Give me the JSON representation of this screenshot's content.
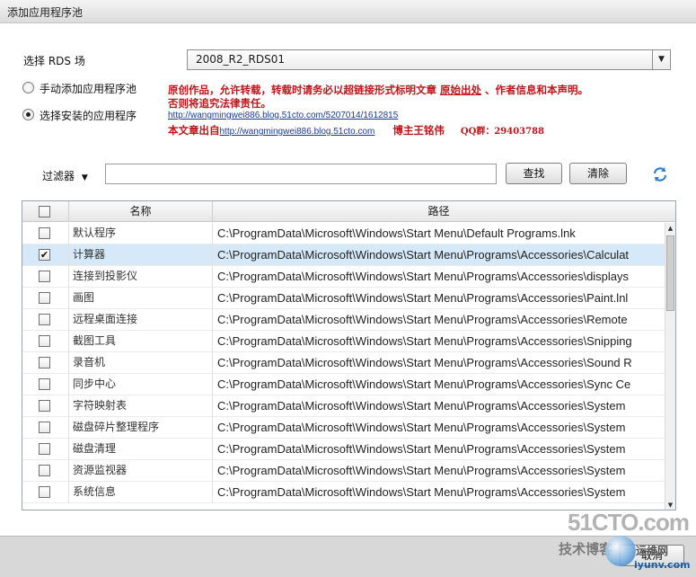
{
  "window": {
    "title": "添加应用程序池"
  },
  "rds": {
    "label": "选择 RDS 场",
    "selected": "2008_R2_RDS01"
  },
  "source_options": [
    {
      "label": "手动添加应用程序池",
      "checked": false
    },
    {
      "label": "选择安装的应用程序",
      "checked": true
    }
  ],
  "notice": {
    "line1_prefix": "原创作品，允许转载，转载时请务必以超链接形式标明文章",
    "line1_link": "原始出处",
    "line1_suffix": "、作者信息和本声明。",
    "line2": "否则将追究法律责任。",
    "url": "http://wangmingwei886.blog.51cto.com/5207014/1612815",
    "line4_prefix": "本文章出自",
    "blog_url": "http://wangmingwei886.blog.51cto.com",
    "author": "博主王铭伟",
    "qq": "QQ群：29403788"
  },
  "filter": {
    "label": "过滤器",
    "value": "",
    "find_label": "查找",
    "clear_label": "清除",
    "refresh_icon": "refresh-icon"
  },
  "table": {
    "columns": [
      "名称",
      "路径"
    ],
    "rows": [
      {
        "name": "默认程序",
        "path": "C:\\ProgramData\\Microsoft\\Windows\\Start Menu\\Default Programs.lnk",
        "checked": false
      },
      {
        "name": "计算器",
        "path": "C:\\ProgramData\\Microsoft\\Windows\\Start Menu\\Programs\\Accessories\\Calculat",
        "checked": true
      },
      {
        "name": "连接到投影仪",
        "path": "C:\\ProgramData\\Microsoft\\Windows\\Start Menu\\Programs\\Accessories\\displays",
        "checked": false
      },
      {
        "name": "画图",
        "path": "C:\\ProgramData\\Microsoft\\Windows\\Start Menu\\Programs\\Accessories\\Paint.lnl",
        "checked": false
      },
      {
        "name": "远程桌面连接",
        "path": "C:\\ProgramData\\Microsoft\\Windows\\Start Menu\\Programs\\Accessories\\Remote",
        "checked": false
      },
      {
        "name": "截图工具",
        "path": "C:\\ProgramData\\Microsoft\\Windows\\Start Menu\\Programs\\Accessories\\Snipping",
        "checked": false
      },
      {
        "name": "录音机",
        "path": "C:\\ProgramData\\Microsoft\\Windows\\Start Menu\\Programs\\Accessories\\Sound R",
        "checked": false
      },
      {
        "name": "同步中心",
        "path": "C:\\ProgramData\\Microsoft\\Windows\\Start Menu\\Programs\\Accessories\\Sync Ce",
        "checked": false
      },
      {
        "name": "字符映射表",
        "path": "C:\\ProgramData\\Microsoft\\Windows\\Start Menu\\Programs\\Accessories\\System",
        "checked": false
      },
      {
        "name": "磁盘碎片整理程序",
        "path": "C:\\ProgramData\\Microsoft\\Windows\\Start Menu\\Programs\\Accessories\\System",
        "checked": false
      },
      {
        "name": "磁盘清理",
        "path": "C:\\ProgramData\\Microsoft\\Windows\\Start Menu\\Programs\\Accessories\\System",
        "checked": false
      },
      {
        "name": "资源监视器",
        "path": "C:\\ProgramData\\Microsoft\\Windows\\Start Menu\\Programs\\Accessories\\System",
        "checked": false
      },
      {
        "name": "系统信息",
        "path": "C:\\ProgramData\\Microsoft\\Windows\\Start Menu\\Programs\\Accessories\\System",
        "checked": false
      }
    ]
  },
  "watermark": {
    "brand": "51CTO.com",
    "sub": "技术博客",
    "cn": "运维网",
    "site": "iyunv.com"
  },
  "footer": {
    "cancel_label": "取消"
  }
}
